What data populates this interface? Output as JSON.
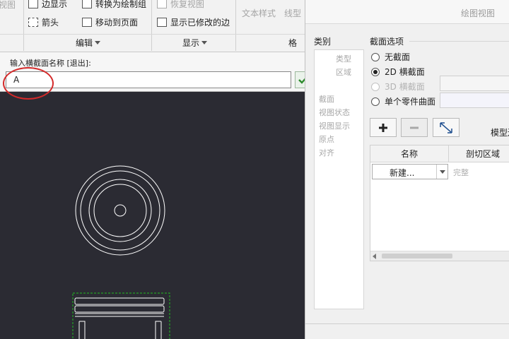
{
  "ribbon": {
    "top_row": {
      "view_partial": "视图",
      "edge_display": "边显示",
      "convert_to_group": "转换为绘制组",
      "restore_view": "恢复视图",
      "text_style": "文本样式",
      "line_style": "线型"
    },
    "arrow": "箭头",
    "move_to_page": "移动到页面",
    "show_modified_edges": "显示已修改的边",
    "groups": {
      "edit": "编辑",
      "display": "显示",
      "format_partial": "格"
    }
  },
  "prompt": {
    "label": "输入横截面名称 [退出]:",
    "value": "A",
    "ok_icon": "checkmark-icon",
    "cancel_label": "x",
    "accent": "#2e8b2e",
    "highlight_color": "#d42a2a"
  },
  "dialog": {
    "title": "绘图视图",
    "category_label": "类别",
    "categories": [
      "类型",
      "区域",
      "截面",
      "视图状态",
      "视图显示",
      "原点",
      "对齐"
    ],
    "section_options_label": "截面选项",
    "options": [
      "无截面",
      "2D 横截面",
      "3D 横截面",
      "单个零件曲面"
    ],
    "selected_option": "2D 横截面",
    "model_label": "模型边",
    "table": {
      "headers": [
        "名称",
        "剖切区域"
      ],
      "row": {
        "name": "新建...",
        "area": "完整"
      }
    },
    "buttons": {
      "add": "add-icon",
      "remove": "remove-icon",
      "flip": "flip-icon"
    }
  }
}
